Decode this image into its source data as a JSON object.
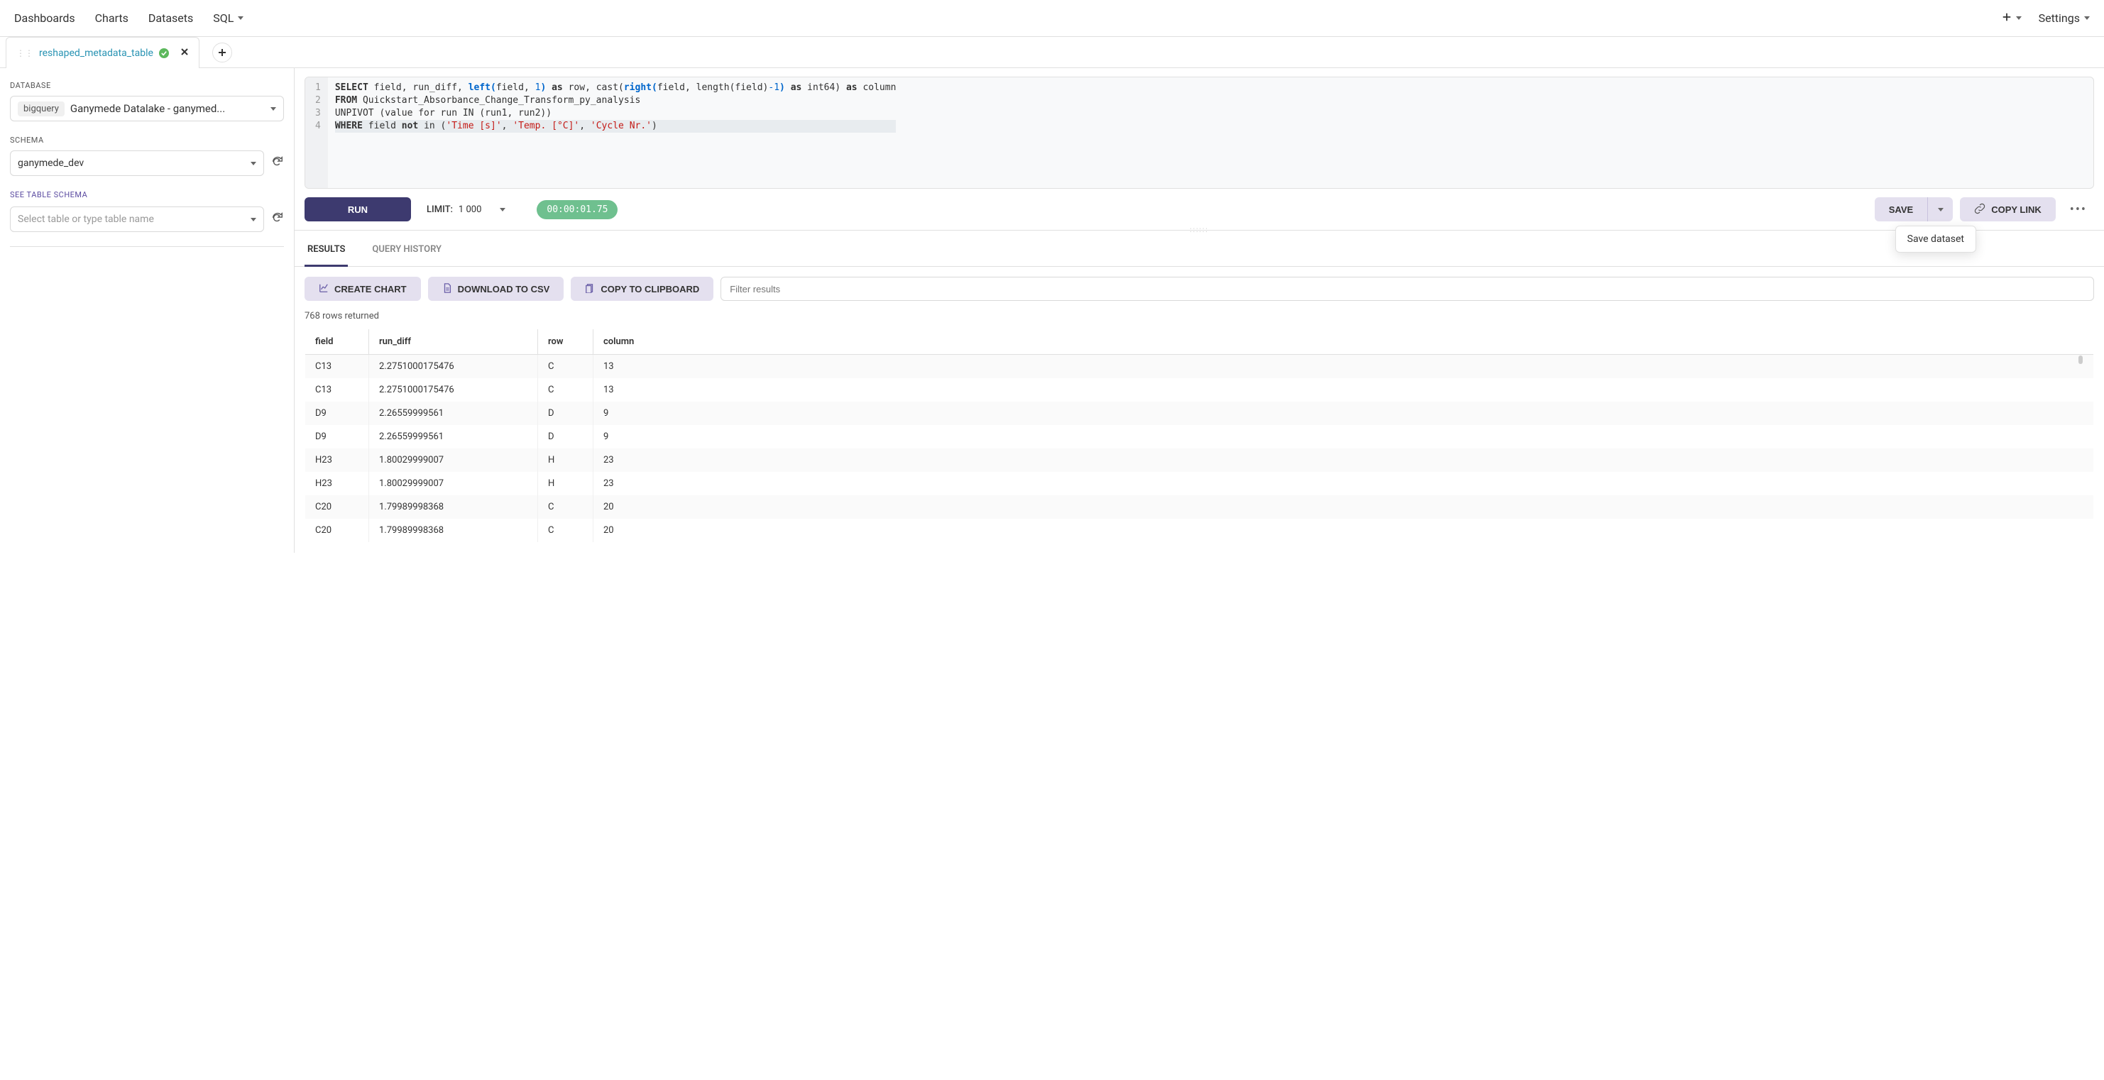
{
  "topnav": {
    "dashboards": "Dashboards",
    "charts": "Charts",
    "datasets": "Datasets",
    "sql": "SQL",
    "settings": "Settings"
  },
  "tab": {
    "name": "reshaped_metadata_table"
  },
  "sidebar": {
    "database_label": "DATABASE",
    "db_engine": "bigquery",
    "db_name": "Ganymede Datalake - ganymed...",
    "schema_label": "SCHEMA",
    "schema_value": "ganymede_dev",
    "see_schema": "SEE TABLE SCHEMA",
    "table_placeholder": "Select table or type table name"
  },
  "editor": {
    "lines": [
      "1",
      "2",
      "3",
      "4"
    ],
    "code_tokens": [
      [
        {
          "t": "SELECT",
          "c": "kw"
        },
        {
          "t": " field, run_diff, "
        },
        {
          "t": "left(",
          "c": "fn"
        },
        {
          "t": "field, "
        },
        {
          "t": "1",
          "c": "num"
        },
        {
          "t": ")",
          "c": "fn"
        },
        {
          "t": " "
        },
        {
          "t": "as",
          "c": "kw"
        },
        {
          "t": " row, cast("
        },
        {
          "t": "right(",
          "c": "fn"
        },
        {
          "t": "field, length(field)"
        },
        {
          "t": "-1",
          "c": "num"
        },
        {
          "t": ")",
          "c": "fn"
        },
        {
          "t": " "
        },
        {
          "t": "as",
          "c": "kw"
        },
        {
          "t": " int64) "
        },
        {
          "t": "as",
          "c": "kw"
        },
        {
          "t": " column"
        }
      ],
      [
        {
          "t": "FROM",
          "c": "kw"
        },
        {
          "t": " Quickstart_Absorbance_Change_Transform_py_analysis"
        }
      ],
      [
        {
          "t": "UNPIVOT (value for run IN (run1, run2))"
        }
      ],
      [
        {
          "t": "WHERE",
          "c": "kw"
        },
        {
          "t": " field "
        },
        {
          "t": "not",
          "c": "kw"
        },
        {
          "t": " in ("
        },
        {
          "t": "'Time [s]'",
          "c": "str"
        },
        {
          "t": ", "
        },
        {
          "t": "'Temp. [°C]'",
          "c": "str"
        },
        {
          "t": ", "
        },
        {
          "t": "'Cycle Nr.'",
          "c": "str"
        },
        {
          "t": ")"
        }
      ]
    ],
    "highlight_line": 4
  },
  "toolbar": {
    "run": "RUN",
    "limit_label": "LIMIT:",
    "limit_value": "1 000",
    "time": "00:00:01.75",
    "save": "SAVE",
    "copy_link": "COPY LINK",
    "save_dropdown": "Save dataset"
  },
  "subtabs": {
    "results": "RESULTS",
    "history": "QUERY HISTORY"
  },
  "results_bar": {
    "create_chart": "CREATE CHART",
    "download_csv": "DOWNLOAD TO CSV",
    "copy_clipboard": "COPY TO CLIPBOARD",
    "filter_placeholder": "Filter results"
  },
  "rows_returned": "768 rows returned",
  "table": {
    "headers": [
      "field",
      "run_diff",
      "row",
      "column"
    ],
    "rows": [
      {
        "field": "C13",
        "run_diff": "2.2751000175476",
        "row": "C",
        "column": "13"
      },
      {
        "field": "C13",
        "run_diff": "2.2751000175476",
        "row": "C",
        "column": "13"
      },
      {
        "field": "D9",
        "run_diff": "2.26559999561",
        "row": "D",
        "column": "9"
      },
      {
        "field": "D9",
        "run_diff": "2.26559999561",
        "row": "D",
        "column": "9"
      },
      {
        "field": "H23",
        "run_diff": "1.80029999007",
        "row": "H",
        "column": "23"
      },
      {
        "field": "H23",
        "run_diff": "1.80029999007",
        "row": "H",
        "column": "23"
      },
      {
        "field": "C20",
        "run_diff": "1.79989998368",
        "row": "C",
        "column": "20"
      },
      {
        "field": "C20",
        "run_diff": "1.79989998368",
        "row": "C",
        "column": "20"
      }
    ]
  }
}
